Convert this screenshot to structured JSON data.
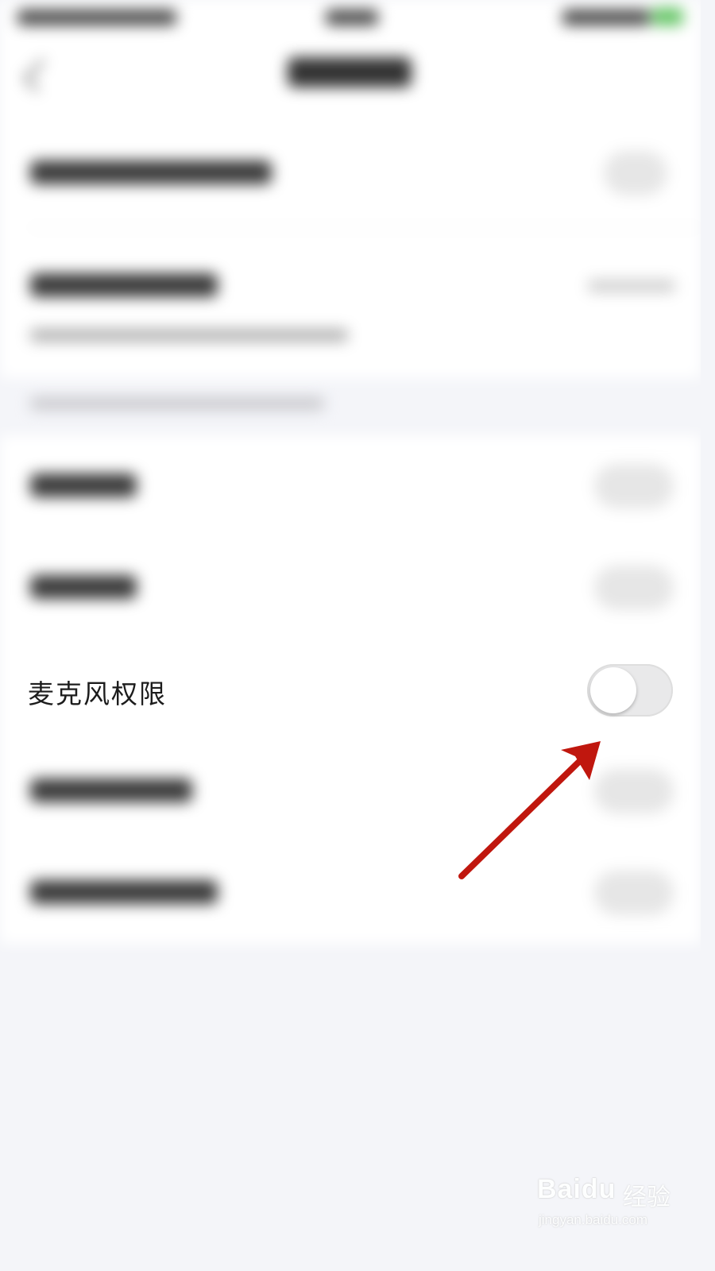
{
  "settings": {
    "microphone_permission": {
      "label": "麦克风权限",
      "enabled": false
    }
  },
  "colors": {
    "annotation_arrow": "#c0170e",
    "toggle_off_track": "#e9e9ea",
    "page_background": "#f4f5f9"
  },
  "watermark": {
    "brand": "Baidu",
    "brand_suffix": "经验",
    "url": "jingyan.baidu.com"
  }
}
